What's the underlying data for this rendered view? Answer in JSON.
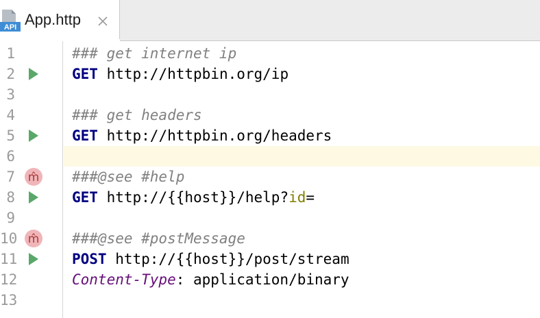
{
  "tab": {
    "icon_label": "API",
    "title": "App.http",
    "close_glyph": "×"
  },
  "colors": {
    "run_icon": "#59a869",
    "method_icon_bg": "#f0b5b8",
    "method_icon_fg": "#a83a3a",
    "comment": "#808080",
    "keyword": "#000080",
    "param": "#808000",
    "header_name": "#660e7a",
    "current_line": "#fdf9e3"
  },
  "lines": [
    {
      "num": "1",
      "marker": "none",
      "parts": [
        {
          "cls": "comment",
          "text": "### get internet ip"
        }
      ]
    },
    {
      "num": "2",
      "marker": "run-icon",
      "parts": [
        {
          "cls": "method",
          "text": "GET"
        },
        {
          "cls": "url",
          "text": " http://httpbin.org/ip"
        }
      ]
    },
    {
      "num": "3",
      "marker": "none",
      "parts": []
    },
    {
      "num": "4",
      "marker": "none",
      "parts": [
        {
          "cls": "comment",
          "text": "### get headers"
        }
      ]
    },
    {
      "num": "5",
      "marker": "run-icon",
      "parts": [
        {
          "cls": "method",
          "text": "GET"
        },
        {
          "cls": "url",
          "text": " http://httpbin.org/headers"
        }
      ]
    },
    {
      "num": "6",
      "marker": "none",
      "parts": []
    },
    {
      "num": "7",
      "marker": "method-icon",
      "parts": [
        {
          "cls": "comment",
          "text": "###@see #help"
        }
      ]
    },
    {
      "num": "8",
      "marker": "run-icon",
      "parts": [
        {
          "cls": "method",
          "text": "GET"
        },
        {
          "cls": "url",
          "text": " http://{{host}}/help?"
        },
        {
          "cls": "param",
          "text": "id"
        },
        {
          "cls": "url",
          "text": "="
        }
      ]
    },
    {
      "num": "9",
      "marker": "none",
      "parts": []
    },
    {
      "num": "10",
      "marker": "method-icon",
      "parts": [
        {
          "cls": "comment",
          "text": "###@see #postMessage"
        }
      ]
    },
    {
      "num": "11",
      "marker": "run-icon",
      "parts": [
        {
          "cls": "method",
          "text": "POST"
        },
        {
          "cls": "url",
          "text": " http://{{host}}/post/stream"
        }
      ]
    },
    {
      "num": "12",
      "marker": "none",
      "parts": [
        {
          "cls": "header-name",
          "text": "Content-Type"
        },
        {
          "cls": "url",
          "text": ": application/binary"
        }
      ]
    },
    {
      "num": "13",
      "marker": "none",
      "parts": []
    }
  ],
  "method_icon_glyph": "m̂"
}
